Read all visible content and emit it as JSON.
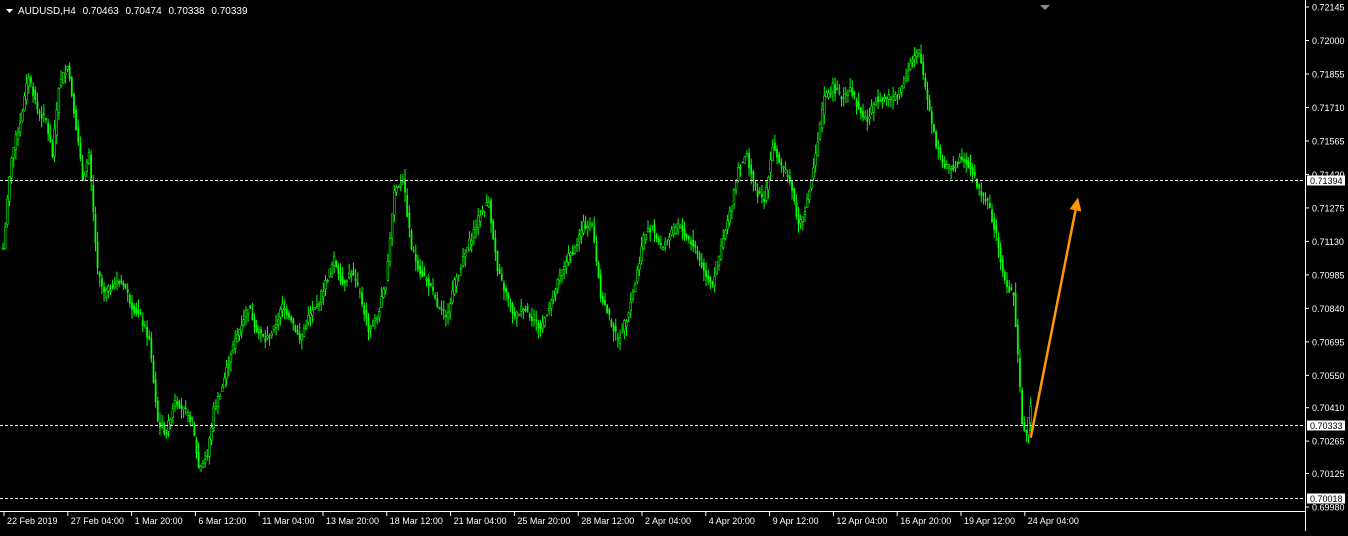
{
  "header": {
    "symbol": "AUDUSD,H4",
    "open": "0.70463",
    "high": "0.70474",
    "low": "0.70338",
    "close": "0.70339"
  },
  "colors": {
    "background": "#000000",
    "candle": "#00ff00",
    "axis": "#ffffff",
    "arrow": "#ff9900",
    "price_label_bg": "#ffffff",
    "price_label_text": "#000000"
  },
  "chart_data": {
    "type": "candlestick",
    "ylim": [
      0.6998,
      0.72145
    ],
    "y_ticks": [
      "0.72145",
      "0.72000",
      "0.71855",
      "0.71710",
      "0.71565",
      "0.71420",
      "0.71275",
      "0.71130",
      "0.70985",
      "0.70840",
      "0.70695",
      "0.70550",
      "0.70410",
      "0.70265",
      "0.70125",
      "0.69980"
    ],
    "x_ticks": [
      "22 Feb 2019",
      "27 Feb 04:00",
      "1 Mar 20:00",
      "6 Mar 12:00",
      "11 Mar 04:00",
      "13 Mar 20:00",
      "18 Mar 12:00",
      "21 Mar 04:00",
      "25 Mar 20:00",
      "28 Mar 12:00",
      "2 Apr 04:00",
      "4 Apr 20:00",
      "9 Apr 12:00",
      "12 Apr 04:00",
      "16 Apr 20:00",
      "19 Apr 12:00",
      "24 Apr 04:00"
    ],
    "horizontal_lines": [
      {
        "value": 0.71394,
        "label": "0.71394"
      },
      {
        "value": 0.70333,
        "label": "0.70333"
      },
      {
        "value": 0.70018,
        "label": "0.70018"
      }
    ],
    "close_path": [
      [
        0,
        0.711
      ],
      [
        4,
        0.715
      ],
      [
        8,
        0.7165
      ],
      [
        12,
        0.7185
      ],
      [
        16,
        0.717
      ],
      [
        20,
        0.7165
      ],
      [
        23,
        0.715
      ],
      [
        26,
        0.718
      ],
      [
        30,
        0.719
      ],
      [
        33,
        0.717
      ],
      [
        37,
        0.714
      ],
      [
        40,
        0.715
      ],
      [
        44,
        0.71
      ],
      [
        47,
        0.709
      ],
      [
        52,
        0.7095
      ],
      [
        56,
        0.7095
      ],
      [
        60,
        0.7085
      ],
      [
        64,
        0.708
      ],
      [
        68,
        0.707
      ],
      [
        72,
        0.7035
      ],
      [
        76,
        0.703
      ],
      [
        80,
        0.7045
      ],
      [
        84,
        0.704
      ],
      [
        88,
        0.7035
      ],
      [
        91,
        0.7015
      ],
      [
        95,
        0.702
      ],
      [
        98,
        0.704
      ],
      [
        102,
        0.705
      ],
      [
        106,
        0.7065
      ],
      [
        110,
        0.7075
      ],
      [
        114,
        0.7085
      ],
      [
        118,
        0.7075
      ],
      [
        122,
        0.707
      ],
      [
        126,
        0.7075
      ],
      [
        130,
        0.7085
      ],
      [
        134,
        0.708
      ],
      [
        138,
        0.707
      ],
      [
        142,
        0.708
      ],
      [
        146,
        0.7085
      ],
      [
        150,
        0.7095
      ],
      [
        154,
        0.7105
      ],
      [
        158,
        0.7095
      ],
      [
        162,
        0.71
      ],
      [
        166,
        0.709
      ],
      [
        170,
        0.7075
      ],
      [
        174,
        0.708
      ],
      [
        178,
        0.7095
      ],
      [
        182,
        0.7135
      ],
      [
        186,
        0.714
      ],
      [
        190,
        0.711
      ],
      [
        194,
        0.71
      ],
      [
        198,
        0.7095
      ],
      [
        202,
        0.7085
      ],
      [
        206,
        0.708
      ],
      [
        210,
        0.7095
      ],
      [
        214,
        0.7105
      ],
      [
        218,
        0.7115
      ],
      [
        222,
        0.7125
      ],
      [
        226,
        0.713
      ],
      [
        230,
        0.71
      ],
      [
        234,
        0.709
      ],
      [
        238,
        0.708
      ],
      [
        242,
        0.7085
      ],
      [
        246,
        0.708
      ],
      [
        250,
        0.7075
      ],
      [
        254,
        0.7085
      ],
      [
        258,
        0.7095
      ],
      [
        262,
        0.7105
      ],
      [
        266,
        0.711
      ],
      [
        270,
        0.712
      ],
      [
        274,
        0.712
      ],
      [
        278,
        0.709
      ],
      [
        282,
        0.708
      ],
      [
        286,
        0.707
      ],
      [
        290,
        0.708
      ],
      [
        294,
        0.7095
      ],
      [
        298,
        0.7115
      ],
      [
        302,
        0.712
      ],
      [
        306,
        0.711
      ],
      [
        310,
        0.7115
      ],
      [
        314,
        0.712
      ],
      [
        318,
        0.7115
      ],
      [
        322,
        0.711
      ],
      [
        326,
        0.71
      ],
      [
        330,
        0.7095
      ],
      [
        334,
        0.711
      ],
      [
        338,
        0.7125
      ],
      [
        342,
        0.7145
      ],
      [
        346,
        0.715
      ],
      [
        350,
        0.7135
      ],
      [
        354,
        0.713
      ],
      [
        358,
        0.7155
      ],
      [
        362,
        0.7145
      ],
      [
        366,
        0.714
      ],
      [
        370,
        0.712
      ],
      [
        374,
        0.713
      ],
      [
        378,
        0.715
      ],
      [
        382,
        0.7175
      ],
      [
        386,
        0.718
      ],
      [
        390,
        0.7175
      ],
      [
        394,
        0.718
      ],
      [
        398,
        0.717
      ],
      [
        402,
        0.7165
      ],
      [
        406,
        0.7175
      ],
      [
        410,
        0.7175
      ],
      [
        414,
        0.7175
      ],
      [
        418,
        0.718
      ],
      [
        422,
        0.719
      ],
      [
        426,
        0.7195
      ],
      [
        430,
        0.7175
      ],
      [
        434,
        0.7155
      ],
      [
        438,
        0.7145
      ],
      [
        442,
        0.7145
      ],
      [
        446,
        0.715
      ],
      [
        450,
        0.7145
      ],
      [
        454,
        0.7135
      ],
      [
        458,
        0.713
      ],
      [
        462,
        0.7115
      ],
      [
        466,
        0.7095
      ],
      [
        470,
        0.709
      ],
      [
        474,
        0.7035
      ],
      [
        476,
        0.703
      ],
      [
        478,
        0.704
      ]
    ],
    "last_candle_index": 478
  },
  "annotation": {
    "arrow": {
      "from": [
        478,
        0.7028
      ],
      "to": [
        500,
        0.7132
      ]
    }
  }
}
